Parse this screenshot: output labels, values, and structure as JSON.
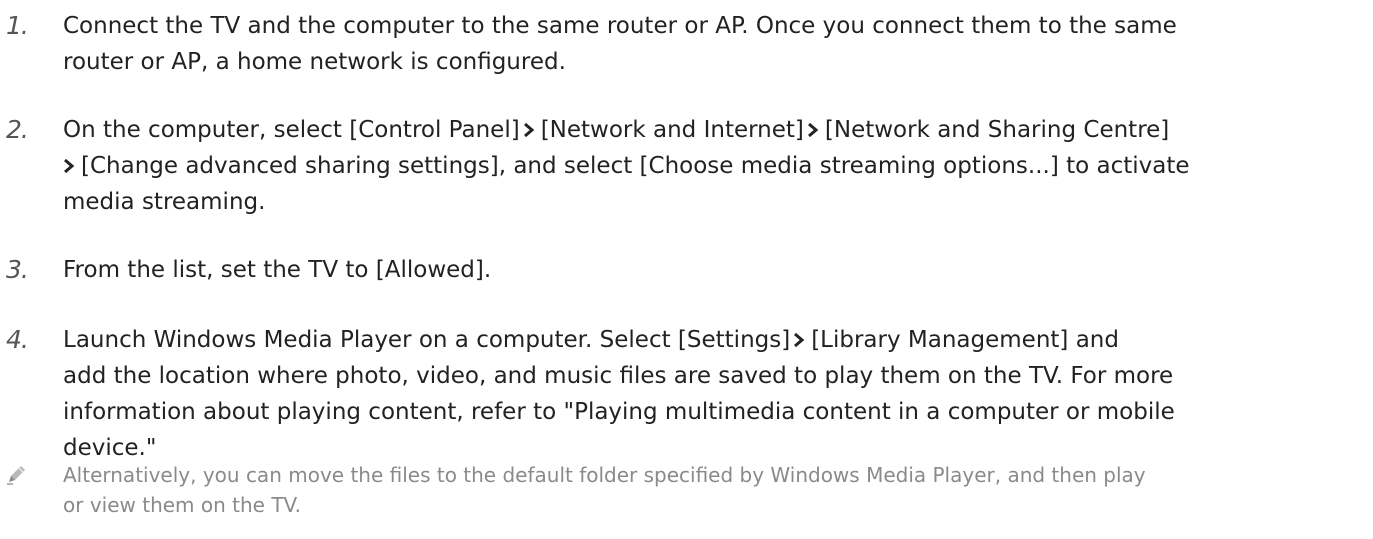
{
  "steps": [
    {
      "number": "1.",
      "lines": [
        [
          "Connect the TV and the computer to the same router or AP. Once you connect them to the same"
        ],
        [
          "router or AP, a home network is configured."
        ]
      ]
    },
    {
      "number": "2.",
      "lines": [
        [
          "On the computer, select [Control Panel]",
          "[Network and Internet]",
          "[Network and Sharing Centre]"
        ],
        [
          "",
          "[Change advanced sharing settings], and select [Choose media streaming options...] to activate"
        ],
        [
          "media streaming."
        ]
      ]
    },
    {
      "number": "3.",
      "lines": [
        [
          "From the list, set the TV to [Allowed]."
        ]
      ]
    },
    {
      "number": "4.",
      "lines": [
        [
          "Launch Windows Media Player on a computer. Select [Settings]",
          "[Library Management] and"
        ],
        [
          "add the location where photo, video, and music files are saved to play them on the TV. For more"
        ],
        [
          "information about playing content, refer to \"Playing multimedia content in a computer or mobile"
        ],
        [
          "device.\""
        ]
      ]
    }
  ],
  "note": {
    "icon": "pencil-icon",
    "lines": [
      "Alternatively, you can move the files to the default folder specified by Windows Media Player, and then play",
      "or view them on the TV."
    ]
  },
  "colors": {
    "body_text": "#222222",
    "step_number": "#555555",
    "note_text": "#8a8a8a",
    "chevron": "#222222"
  }
}
